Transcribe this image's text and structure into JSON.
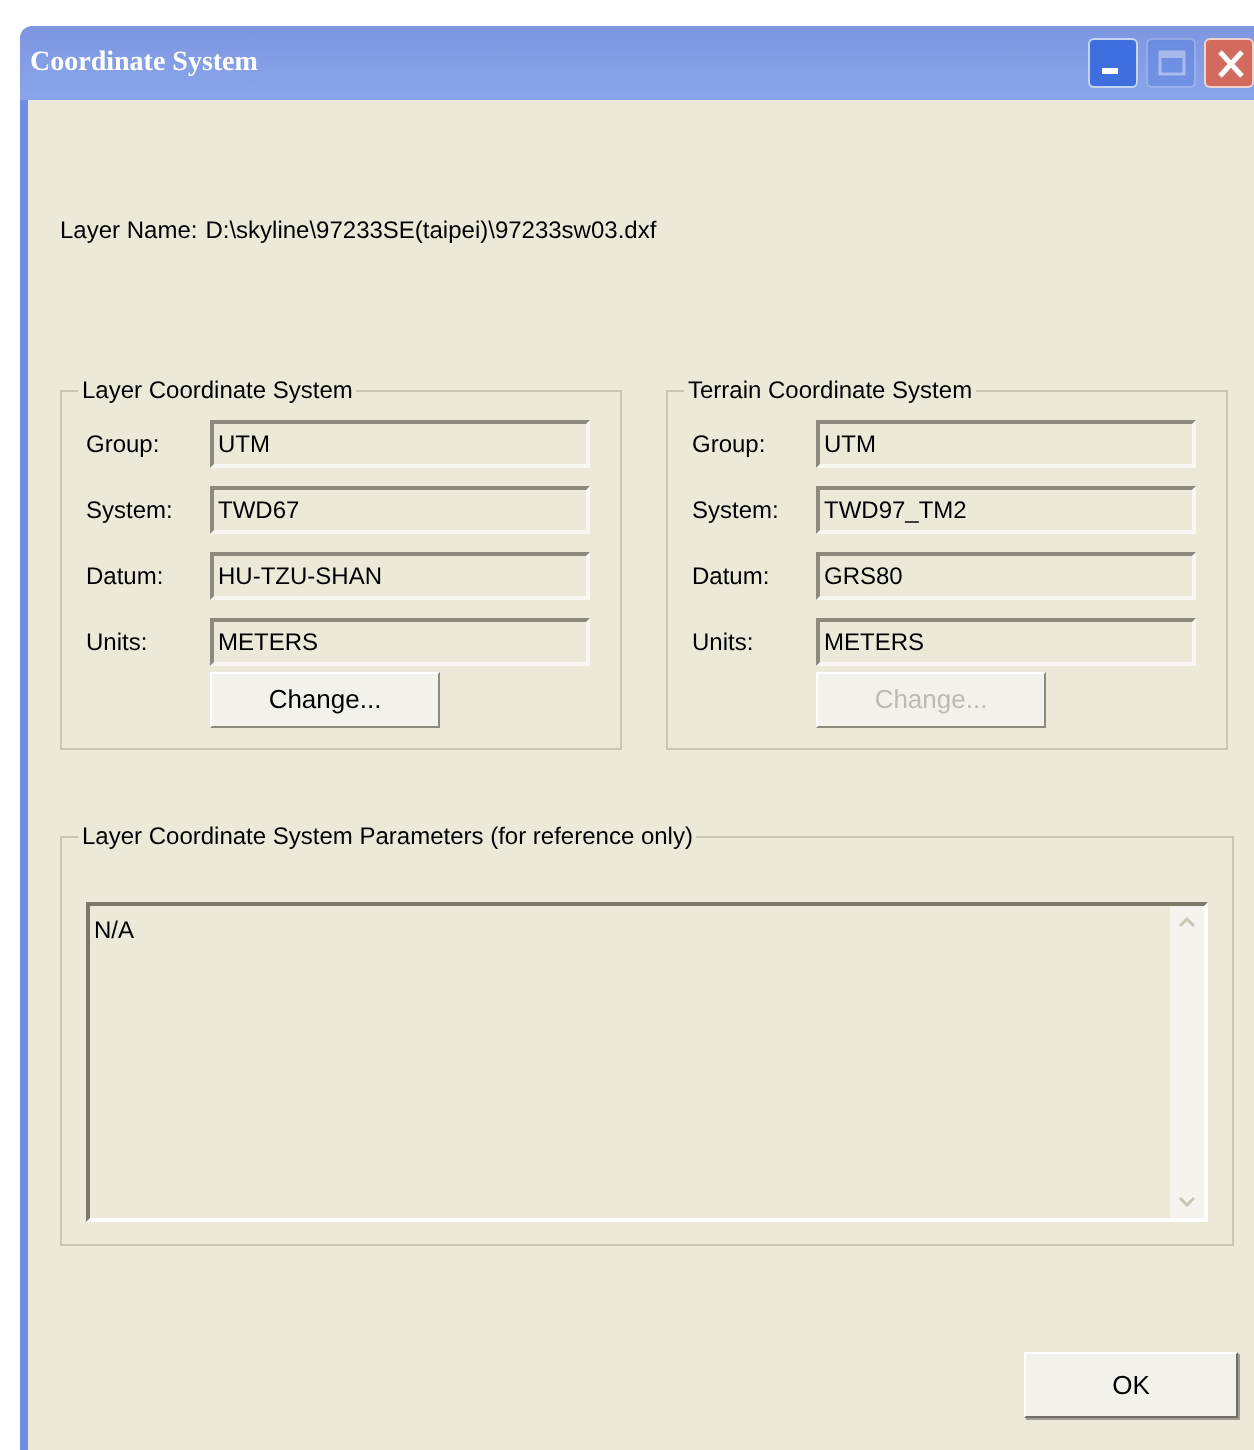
{
  "window": {
    "title": "Coordinate System",
    "controls": [
      {
        "kind": "minimize",
        "disabled": false
      },
      {
        "kind": "maximize",
        "disabled": true
      },
      {
        "kind": "close",
        "disabled": false
      }
    ]
  },
  "layer_name": {
    "label": "Layer Name:",
    "value": "D:\\skyline\\97233SE(taipei)\\97233sw03.dxf"
  },
  "groups": [
    {
      "title": "Layer Coordinate System",
      "fields": [
        {
          "label": "Group:",
          "value": "UTM"
        },
        {
          "label": "System:",
          "value": "TWD67"
        },
        {
          "label": "Datum:",
          "value": "HU-TZU-SHAN"
        },
        {
          "label": "Units:",
          "value": "METERS"
        }
      ],
      "button": {
        "label": "Change...",
        "disabled": false
      }
    },
    {
      "title": "Terrain Coordinate System",
      "fields": [
        {
          "label": "Group:",
          "value": "UTM"
        },
        {
          "label": "System:",
          "value": "TWD97_TM2"
        },
        {
          "label": "Datum:",
          "value": "GRS80"
        },
        {
          "label": "Units:",
          "value": "METERS"
        }
      ],
      "button": {
        "label": "Change...",
        "disabled": true
      }
    }
  ],
  "parameters": {
    "title": "Layer Coordinate System Parameters (for reference only)",
    "value": "N/A"
  },
  "ok_button": {
    "label": "OK"
  }
}
